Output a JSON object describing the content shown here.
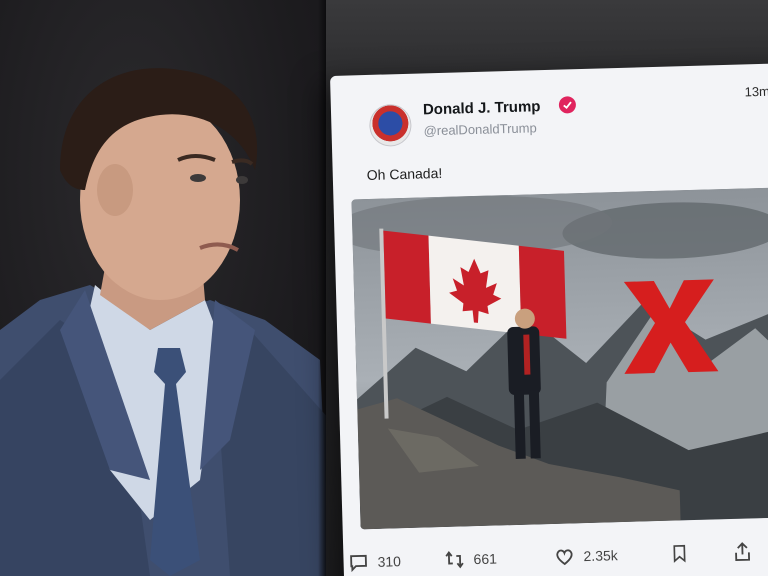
{
  "post": {
    "author_name": "Donald J. Trump",
    "handle": "@realDonaldTrump",
    "timestamp": "13m",
    "text": "Oh Canada!",
    "stats": {
      "replies": "310",
      "reposts": "661",
      "likes": "2.35k"
    }
  },
  "icons": {
    "verified": "verified-badge-icon",
    "reply": "comment-icon",
    "repost": "repost-icon",
    "like": "heart-icon",
    "bookmark": "bookmark-icon",
    "share": "share-icon"
  },
  "colors": {
    "verified_badge": "#e0245e",
    "x_mark": "#d61e1e",
    "flag_red": "#c8202a"
  }
}
